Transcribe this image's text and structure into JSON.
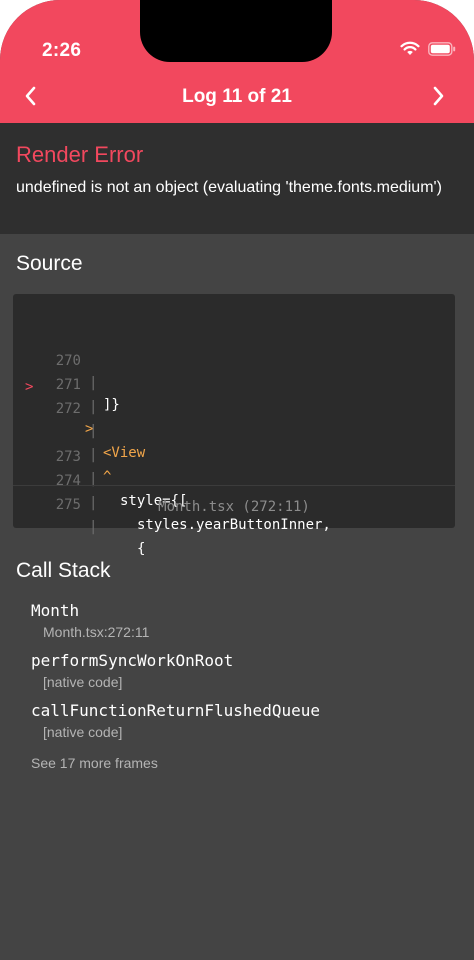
{
  "status_bar": {
    "time": "2:26",
    "icons": [
      "signal-icon",
      "wifi-icon",
      "battery-icon"
    ]
  },
  "nav": {
    "title": "Log 11 of 21",
    "back_icon": "chevron-left-icon",
    "forward_icon": "chevron-right-icon"
  },
  "error": {
    "title": "Render Error",
    "message": "undefined is not an object (evaluating 'theme.fonts.medium')"
  },
  "source": {
    "heading": "Source",
    "lines": [
      {
        "marker": "",
        "num": "270",
        "sep": "|",
        "code": "]}"
      },
      {
        "marker": "",
        "num": "271",
        "sep": "|",
        "code": ">"
      },
      {
        "marker": ">",
        "num": "272",
        "sep": "|",
        "code": "<View"
      },
      {
        "marker": "",
        "num": "",
        "sep": "|",
        "code": "^"
      },
      {
        "marker": "",
        "num": "273",
        "sep": "|",
        "code": "style={["
      },
      {
        "marker": "",
        "num": "274",
        "sep": "|",
        "code": "styles.yearButtonInner,"
      },
      {
        "marker": "",
        "num": "275",
        "sep": "|",
        "code": "{"
      }
    ],
    "file_location": "Month.tsx (272:11)"
  },
  "call_stack": {
    "heading": "Call Stack",
    "frames": [
      {
        "name": "Month",
        "location": "Month.tsx:272:11"
      },
      {
        "name": "performSyncWorkOnRoot",
        "location": "[native code]"
      },
      {
        "name": "callFunctionReturnFlushedQueue",
        "location": "[native code]"
      }
    ],
    "more_label": "See 17 more frames"
  },
  "colors": {
    "accent": "#f2485e",
    "highlight": "#f2a64a",
    "background": "#444444",
    "panel": "#2f2f2f",
    "code_background": "#2b2b2b"
  }
}
